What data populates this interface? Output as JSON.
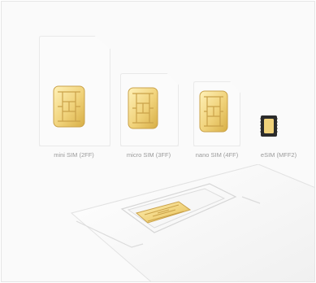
{
  "labels": {
    "mini": "mini SIM (2FF)",
    "micro": "micro SIM (3FF)",
    "nano": "nano SIM (4FF)",
    "esim": "eSIM (MFF2)"
  },
  "colors": {
    "card": "#fbfbfb",
    "chip_gold": "#f0d27a",
    "chip_dark": "#c79b2e",
    "esim_body": "#2b2b2b",
    "label": "#9a9a9a"
  },
  "icons": {
    "sim_chip": "sim-chip-icon",
    "esim_chip": "esim-chip-icon"
  }
}
